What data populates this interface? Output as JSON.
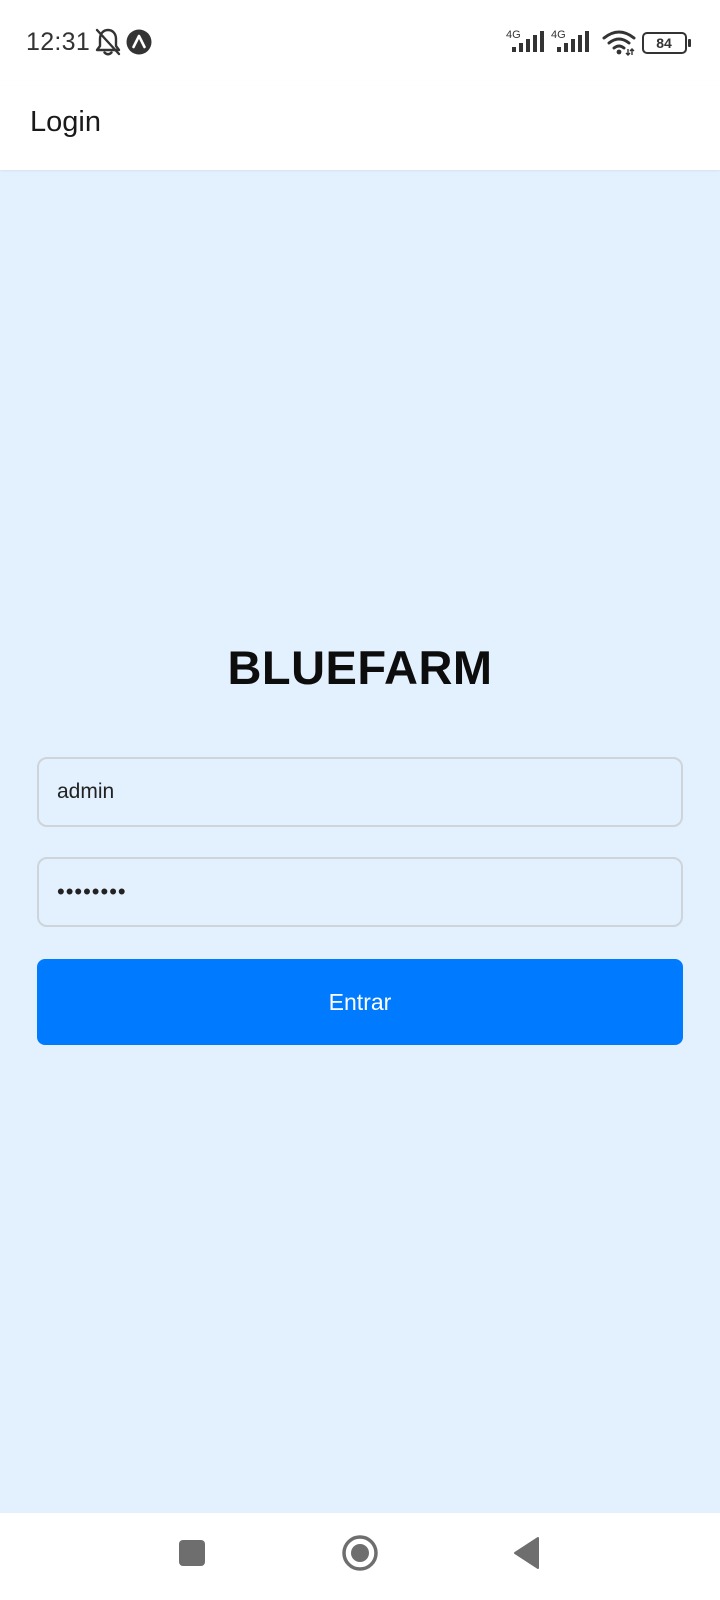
{
  "status_bar": {
    "time": "12:31",
    "battery_level": "84",
    "network_1": "4G",
    "network_2": "4G",
    "icons": [
      "bell-off-icon",
      "navigation-app-icon",
      "signal-4g-icon",
      "signal-4g-icon",
      "wifi-icon",
      "battery-icon"
    ]
  },
  "header": {
    "title": "Login"
  },
  "login": {
    "brand": "BLUEFARM",
    "username_value": "admin",
    "password_value": "••••••••",
    "submit_label": "Entrar"
  },
  "colors": {
    "background": "#e3f0fd",
    "primary_button": "#007bff",
    "header_bg": "#ffffff"
  },
  "nav_bar": {
    "icons": [
      "recents-icon",
      "home-icon",
      "back-icon"
    ]
  }
}
